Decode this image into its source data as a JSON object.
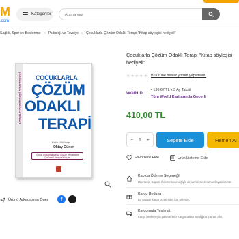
{
  "header": {
    "logo_text": "M",
    "logo_sub": ".com",
    "categories_label": "Kategoriler",
    "search_placeholder": "Arama yap"
  },
  "breadcrumb": [
    "Sağlık, Spor ve Beslenme",
    "Psikoloji ve Tavsiye",
    "Çocuklarla Çözüm Odaklı Terapi \"Kitap söyleşisi hediyeli\""
  ],
  "book": {
    "spine_text": "ÇOCUKLARLA ÇÖZÜM ODAKLI TERAPİ",
    "cover_line1": "ÇOCUKLARLA",
    "cover_line2": "ÇÖZÜM",
    "cover_line3": "ODAKLI",
    "cover_line4": "TERAPİ",
    "author_sub": "Editör / Bölümler",
    "author": "Oktay Güner",
    "blurb": "Çocuk Uygulamalarında Çözüm ve Merkezli Çözümsel Terapi Yaklaşımı"
  },
  "product": {
    "title": "Çocuklarla Çözüm Odaklı Terapi \"Kitap söyleşisi hediyeli\"",
    "review_link": "Bu ürüne henüz yorum yapılmadı.",
    "rating": 0,
    "card_logo": "WORLD",
    "installment": "136,67 TL x 3 Ay Taksit",
    "card_name": "Tüm World Kartlarında Geçerli",
    "price": "410,00 TL",
    "quantity": "1",
    "qty_minus": "−",
    "qty_plus": "+",
    "add_to_cart": "Sepete Ekle",
    "buy_now": "Hemen Al",
    "favorites": "Favorilere Ekle",
    "list": "Ürün Listeme Ekle"
  },
  "features": [
    {
      "icon": "home-icon",
      "title": "Kapıda Ödeme Seçeneği!",
      "sub": "Dilerseniz Kapıda Ödeme seçeneğiyle alışverişlerinizi tamamlayabilirsiniz."
    },
    {
      "icon": "gift-icon",
      "title": "Kargo Bedava",
      "sub": "Bu ürünün kargo ücreti sizin için ücretsiz."
    },
    {
      "icon": "truck-icon",
      "title": "Kargomata Teslimat",
      "sub": "Kargo beklemeyin paketlerinizi Kargomattan istediğiniz zaman alın."
    }
  ],
  "share": {
    "label": "Ürünü Arkadaşına Öner",
    "fb": "f"
  },
  "colors": {
    "accent_yellow": "#f5b800",
    "cart_blue": "#1a90d9",
    "price_green": "#2e8b2e",
    "world_purple": "#6b2d8f",
    "cover_blue": "#0e56a8"
  }
}
